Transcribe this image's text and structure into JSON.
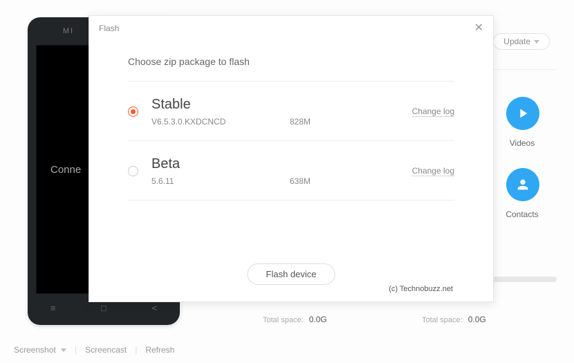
{
  "modal": {
    "title": "Flash",
    "prompt": "Choose zip package to flash",
    "options": [
      {
        "name": "Stable",
        "version": "V6.5.3.0.KXDCNCD",
        "size": "828M",
        "selected": true,
        "changelog_label": "Change log"
      },
      {
        "name": "Beta",
        "version": "5.6.11",
        "size": "638M",
        "selected": false,
        "changelog_label": "Change log"
      }
    ],
    "flash_button": "Flash device",
    "watermark": "(c) Technobuzz.net"
  },
  "header": {
    "update_label": "Update"
  },
  "side_icons": {
    "videos": "Videos",
    "contacts": "Contacts"
  },
  "storage": {
    "left": {
      "label": "Total space:",
      "value": "0.0G"
    },
    "right": {
      "label": "Total space:",
      "value": "0.0G"
    }
  },
  "phone": {
    "status_text": "Conne",
    "logo": "MI"
  },
  "bottom": {
    "screenshot": "Screenshot",
    "screencast": "Screencast",
    "refresh": "Refresh"
  }
}
